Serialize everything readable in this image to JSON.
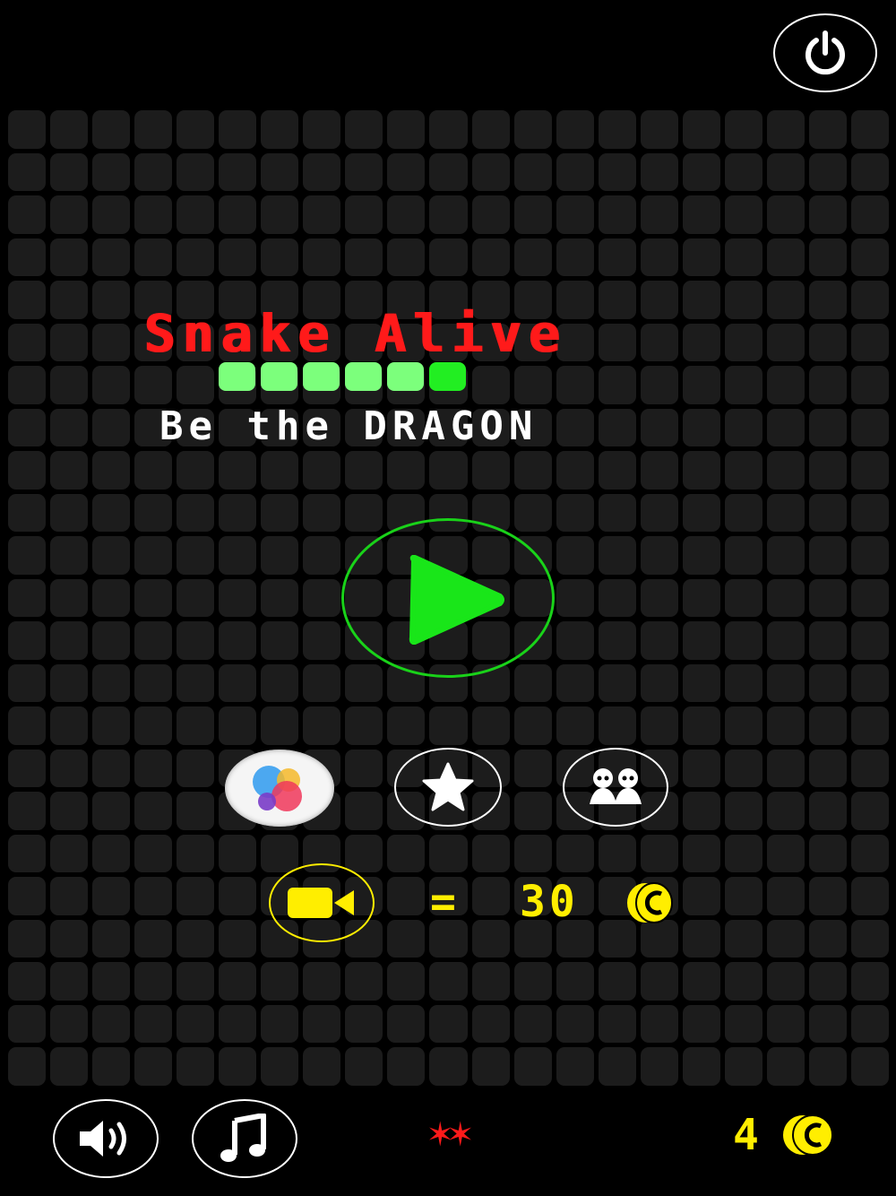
{
  "title": "Snake Alive",
  "subtitle": "Be the DRAGON",
  "snake_segments": 6,
  "reward": {
    "equals": "=",
    "amount": "30",
    "currency_icon": "coin-icon"
  },
  "coins": {
    "count": "4",
    "currency_icon": "coin-icon"
  },
  "stars_display": "✶✶",
  "colors": {
    "background": "#000000",
    "grid_cell": "#1c1c1c",
    "title": "#ff1a1a",
    "snake_body": "#7cff7c",
    "snake_head": "#22ee22",
    "play": "#19d219",
    "accent_yellow": "#ffee00"
  },
  "icons": {
    "power": "power-icon",
    "play": "play-icon",
    "game_center": "game-center-icon",
    "rate": "star-icon",
    "multiplayer": "two-people-icon",
    "video": "video-camera-icon",
    "sound": "speaker-icon",
    "music": "music-note-icon"
  }
}
